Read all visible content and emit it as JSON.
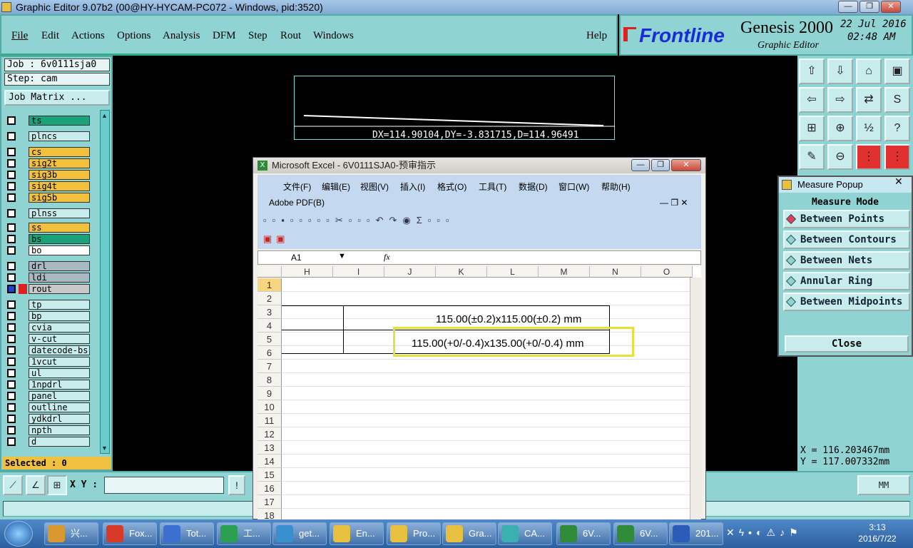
{
  "window": {
    "title": "Graphic Editor 9.07b2 (00@HY-HYCAM-PC072 - Windows, pid:3520)",
    "buttons": [
      "—",
      "❐",
      "✕"
    ]
  },
  "menu": {
    "items": [
      "File",
      "Edit",
      "Actions",
      "Options",
      "Analysis",
      "DFM",
      "Step",
      "Rout",
      "Windows"
    ],
    "help": "Help"
  },
  "brand": {
    "logo": "Frontline",
    "product": "Genesis 2000",
    "subtitle": "Graphic Editor",
    "date": "22 Jul 2016",
    "time": "02:48 AM"
  },
  "left": {
    "job": "Job : 6v0111sja0",
    "step": "Step: cam",
    "job_matrix": "Job Matrix ...",
    "selected": "Selected : 0"
  },
  "layers": [
    {
      "name": "ts",
      "color": "#1aa37a"
    },
    {
      "name": "plncs",
      "color": "#c8ecec"
    },
    {
      "name": "cs",
      "color": "#f2c03a"
    },
    {
      "name": "sig2t",
      "color": "#f2c03a"
    },
    {
      "name": "sig3b",
      "color": "#f2c03a"
    },
    {
      "name": "sig4t",
      "color": "#f2c03a"
    },
    {
      "name": "sig5b",
      "color": "#f2c03a"
    },
    {
      "name": "plnss",
      "color": "#c8ecec"
    },
    {
      "name": "ss",
      "color": "#f2c03a"
    },
    {
      "name": "bs",
      "color": "#1aa37a"
    },
    {
      "name": "bo",
      "color": "#ffffff"
    },
    {
      "name": "drl",
      "color": "#a9b9c2"
    },
    {
      "name": "ldi",
      "color": "#a9b9c2"
    },
    {
      "name": "rout",
      "color": "#c8c8c8"
    },
    {
      "name": "tp",
      "color": "#c8ecec"
    },
    {
      "name": "bp",
      "color": "#c8ecec"
    },
    {
      "name": "cvia",
      "color": "#c8ecec"
    },
    {
      "name": "v-cut",
      "color": "#c8ecec"
    },
    {
      "name": "datecode-bs",
      "color": "#c8ecec"
    },
    {
      "name": "1vcut",
      "color": "#c8ecec"
    },
    {
      "name": "ul",
      "color": "#c8ecec"
    },
    {
      "name": "1npdrl",
      "color": "#c8ecec"
    },
    {
      "name": "panel",
      "color": "#c8ecec"
    },
    {
      "name": "outline",
      "color": "#c8ecec"
    },
    {
      "name": "ydkdrl",
      "color": "#c8ecec"
    },
    {
      "name": "npth",
      "color": "#c8ecec"
    },
    {
      "name": "d",
      "color": "#c8ecec"
    }
  ],
  "canvas": {
    "measure_text": "DX=114.90104,DY=-3.831715,D=114.96491"
  },
  "measure_popup": {
    "title": "Measure Popup",
    "mode_label": "Measure Mode",
    "options": [
      "Between Points",
      "Between Contours",
      "Between Nets",
      "Annular Ring",
      "Between Midpoints"
    ],
    "selected": "Between Points",
    "close": "Close"
  },
  "coords": {
    "x": "X  =  116.203467mm",
    "y": "Y  =  117.007332mm"
  },
  "xybar": {
    "label": "X Y :",
    "value": "",
    "units": "MM"
  },
  "excel": {
    "title": "Microsoft Excel - 6V0111SJA0-预审指示",
    "menu": [
      "文件(F)",
      "编辑(E)",
      "视图(V)",
      "插入(I)",
      "格式(O)",
      "工具(T)",
      "数据(D)",
      "窗口(W)",
      "帮助(H)"
    ],
    "adobe": "Adobe PDF(B)",
    "cell_ref": "A1",
    "fx": "fx",
    "columns": [
      "H",
      "I",
      "J",
      "K",
      "L",
      "M",
      "N",
      "O"
    ],
    "rows": [
      "1",
      "2",
      "3",
      "4",
      "5",
      "6",
      "7",
      "8",
      "9",
      "10",
      "11",
      "12",
      "13",
      "14",
      "15",
      "16",
      "17",
      "18"
    ],
    "cell_row3": "115.00(±0.2)x115.00(±0.2) mm",
    "cell_row5": "115.00(+0/-0.4)x135.00(+0/-0.4) mm"
  },
  "taskbar": {
    "items": [
      "兴...",
      "Fox...",
      "Tot...",
      "工...",
      "get...",
      "En...",
      "Pro...",
      "Gra...",
      "CA...",
      "6V...",
      "6V...",
      "201..."
    ],
    "clock_time": "3:13",
    "clock_date": "2016/7/22"
  }
}
